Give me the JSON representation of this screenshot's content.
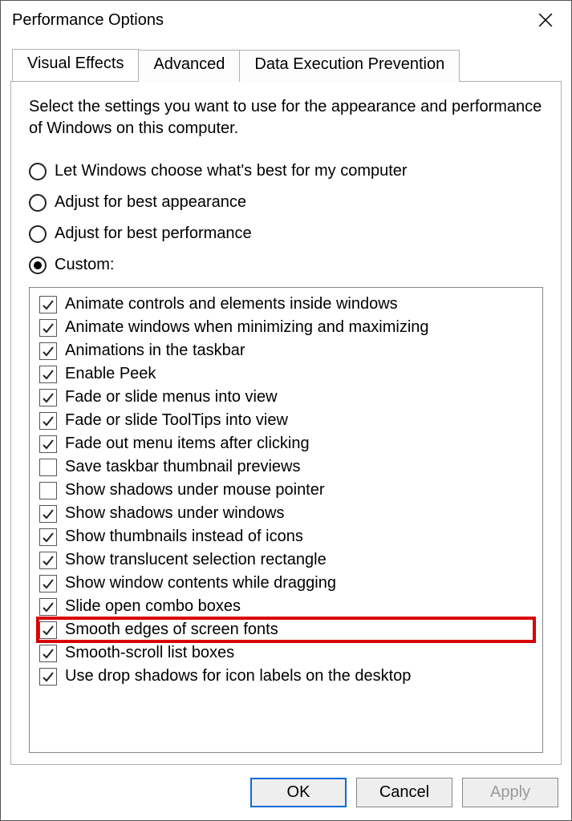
{
  "window": {
    "title": "Performance Options"
  },
  "tabs": [
    {
      "label": "Visual Effects",
      "active": true
    },
    {
      "label": "Advanced",
      "active": false
    },
    {
      "label": "Data Execution Prevention",
      "active": false
    }
  ],
  "intro": "Select the settings you want to use for the appearance and performance of Windows on this computer.",
  "radios": [
    {
      "label": "Let Windows choose what's best for my computer",
      "checked": false
    },
    {
      "label": "Adjust for best appearance",
      "checked": false
    },
    {
      "label": "Adjust for best performance",
      "checked": false
    },
    {
      "label": "Custom:",
      "checked": true
    }
  ],
  "checks": [
    {
      "label": "Animate controls and elements inside windows",
      "checked": true,
      "highlight": false
    },
    {
      "label": "Animate windows when minimizing and maximizing",
      "checked": true,
      "highlight": false
    },
    {
      "label": "Animations in the taskbar",
      "checked": true,
      "highlight": false
    },
    {
      "label": "Enable Peek",
      "checked": true,
      "highlight": false
    },
    {
      "label": "Fade or slide menus into view",
      "checked": true,
      "highlight": false
    },
    {
      "label": "Fade or slide ToolTips into view",
      "checked": true,
      "highlight": false
    },
    {
      "label": "Fade out menu items after clicking",
      "checked": true,
      "highlight": false
    },
    {
      "label": "Save taskbar thumbnail previews",
      "checked": false,
      "highlight": false
    },
    {
      "label": "Show shadows under mouse pointer",
      "checked": false,
      "highlight": false
    },
    {
      "label": "Show shadows under windows",
      "checked": true,
      "highlight": false
    },
    {
      "label": "Show thumbnails instead of icons",
      "checked": true,
      "highlight": false
    },
    {
      "label": "Show translucent selection rectangle",
      "checked": true,
      "highlight": false
    },
    {
      "label": "Show window contents while dragging",
      "checked": true,
      "highlight": false
    },
    {
      "label": "Slide open combo boxes",
      "checked": true,
      "highlight": false
    },
    {
      "label": "Smooth edges of screen fonts",
      "checked": true,
      "highlight": true
    },
    {
      "label": "Smooth-scroll list boxes",
      "checked": true,
      "highlight": false
    },
    {
      "label": "Use drop shadows for icon labels on the desktop",
      "checked": true,
      "highlight": false
    }
  ],
  "buttons": {
    "ok": "OK",
    "cancel": "Cancel",
    "apply": "Apply"
  }
}
